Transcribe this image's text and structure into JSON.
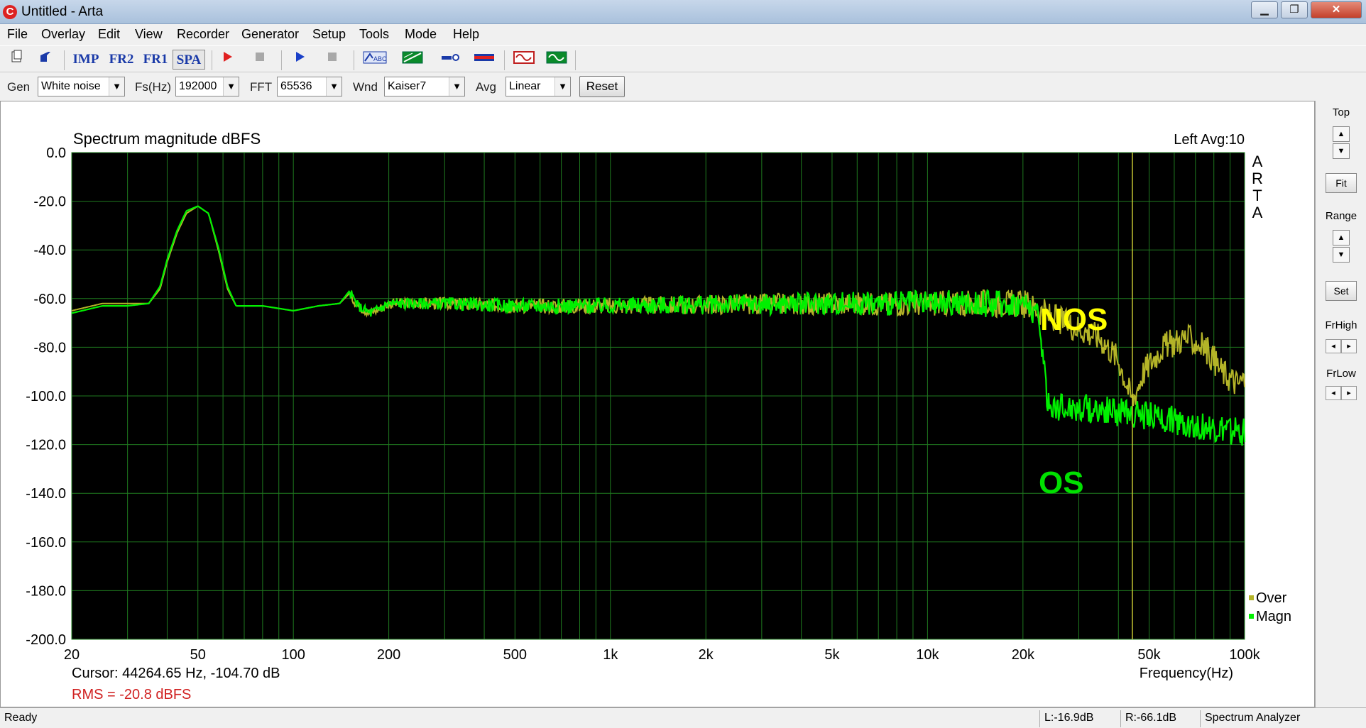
{
  "window": {
    "title": "Untitled - Arta",
    "icon": "arta-app-icon"
  },
  "menu": [
    "File",
    "Overlay",
    "Edit",
    "View",
    "Recorder",
    "Generator",
    "Setup",
    "Tools",
    "Mode",
    "Help"
  ],
  "toolbar": {
    "imp": "IMP",
    "fr2": "FR2",
    "fr1": "FR1",
    "spa": "SPA"
  },
  "options": {
    "gen_label": "Gen",
    "gen_value": "White noise",
    "fs_label": "Fs(Hz)",
    "fs_value": "192000",
    "fft_label": "FFT",
    "fft_value": "65536",
    "wnd_label": "Wnd",
    "wnd_value": "Kaiser7",
    "avg_label": "Avg",
    "avg_value": "Linear",
    "reset": "Reset"
  },
  "right_panel": {
    "top": "Top",
    "fit": "Fit",
    "range": "Range",
    "set": "Set",
    "frhigh": "FrHigh",
    "frlow": "FrLow"
  },
  "status": {
    "ready": "Ready",
    "left_level": "L:-16.9dB",
    "right_level": "R:-66.1dB",
    "mode": "Spectrum Analyzer"
  },
  "chart_data": {
    "type": "line",
    "title": "Spectrum magnitude dBFS",
    "channel_info": "Left  Avg:10",
    "watermark": "ARTA",
    "xlabel": "Frequency(Hz)",
    "ylabel": "",
    "x_scale": "log",
    "xlim": [
      20,
      100000
    ],
    "ylim": [
      -200,
      0
    ],
    "grid": true,
    "background": "#000000",
    "grid_color": "#1f7a1f",
    "x_ticks": [
      20,
      50,
      100,
      200,
      500,
      1000,
      2000,
      5000,
      10000,
      20000,
      50000,
      100000
    ],
    "x_tick_labels": [
      "20",
      "50",
      "100",
      "200",
      "500",
      "1k",
      "2k",
      "5k",
      "10k",
      "20k",
      "50k",
      "100k"
    ],
    "y_ticks": [
      0,
      -20,
      -40,
      -60,
      -80,
      -100,
      -120,
      -140,
      -160,
      -180,
      -200
    ],
    "y_tick_labels": [
      "0.0",
      "-20.0",
      "-40.0",
      "-60.0",
      "-80.0",
      "-100.0",
      "-120.0",
      "-140.0",
      "-160.0",
      "-180.0",
      "-200.0"
    ],
    "cursor": {
      "x": 44264.65,
      "y": -104.7,
      "color": "#c8c832"
    },
    "cursor_text": "Cursor: 44264.65 Hz, -104.70 dB",
    "rms_text": "RMS =  -20.8 dBFS",
    "annotations": [
      {
        "text": "NOS",
        "color": "#ffff00"
      },
      {
        "text": "OS",
        "color": "#00e000"
      }
    ],
    "legend": {
      "placement": "bottom-right"
    },
    "series": [
      {
        "name": "Over",
        "color": "#b4b428",
        "x": [
          20,
          25,
          30,
          35,
          38,
          40,
          43,
          46,
          50,
          54,
          58,
          62,
          66,
          80,
          100,
          120,
          140,
          150,
          160,
          175,
          200,
          300,
          500,
          1000,
          2000,
          5000,
          10000,
          15000,
          20000,
          22000,
          25000,
          30000,
          35000,
          40000,
          44264,
          48000,
          55000,
          65000,
          75000,
          85000,
          95000,
          100000
        ],
        "y": [
          -65,
          -62,
          -62,
          -62,
          -56,
          -45,
          -33,
          -25,
          -22,
          -25,
          -40,
          -56,
          -63,
          -63,
          -65,
          -63,
          -62,
          -58,
          -63,
          -66,
          -62,
          -62,
          -63,
          -63,
          -62.5,
          -62,
          -62,
          -62,
          -62,
          -64,
          -68,
          -72,
          -76,
          -85,
          -102,
          -90,
          -80,
          -76,
          -80,
          -90,
          -95,
          -93
        ]
      },
      {
        "name": "Magn",
        "color": "#00f000",
        "x": [
          20,
          25,
          30,
          35,
          38,
          40,
          43,
          46,
          50,
          54,
          58,
          62,
          66,
          80,
          100,
          120,
          140,
          150,
          160,
          175,
          200,
          300,
          500,
          1000,
          2000,
          5000,
          10000,
          15000,
          20000,
          22000,
          23000,
          24000,
          30000,
          44264,
          60000,
          80000,
          100000
        ],
        "y": [
          -66,
          -63,
          -63,
          -62,
          -55,
          -44,
          -32,
          -24,
          -22,
          -25,
          -39,
          -55,
          -63,
          -63,
          -65,
          -63,
          -62,
          -57,
          -63,
          -66,
          -62,
          -62,
          -63,
          -63,
          -62.5,
          -62,
          -62,
          -62,
          -62,
          -65,
          -80,
          -104,
          -105,
          -107,
          -110,
          -114,
          -115
        ]
      }
    ]
  }
}
